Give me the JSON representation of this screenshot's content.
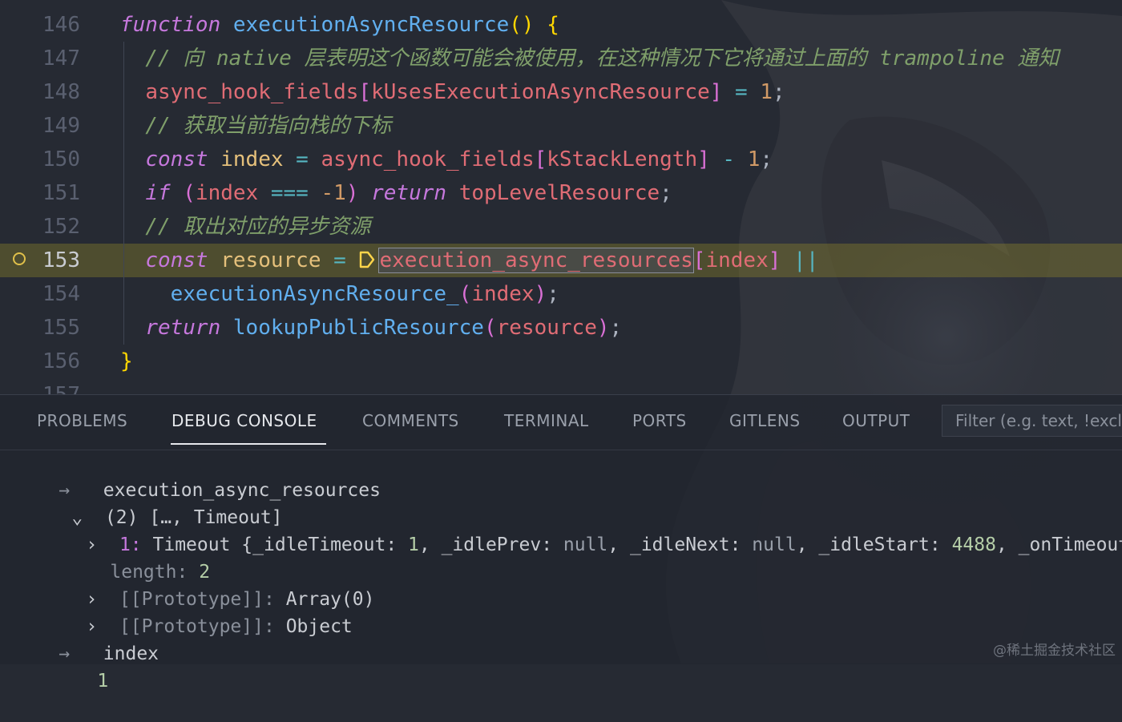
{
  "editor": {
    "lines": [
      {
        "num": "146",
        "tokens": [
          {
            "t": "function",
            "c": "k"
          },
          {
            "t": " ",
            "c": "plain"
          },
          {
            "t": "executionAsyncResource",
            "c": "fn"
          },
          {
            "t": "()",
            "c": "br"
          },
          {
            "t": " ",
            "c": "plain"
          },
          {
            "t": "{",
            "c": "br"
          }
        ]
      },
      {
        "num": "147",
        "tokens": [
          {
            "t": "  // 向 native 层表明这个函数可能会被使用，在这种情况下它将通过上面的 trampoline 通知",
            "c": "cm"
          }
        ]
      },
      {
        "num": "148",
        "tokens": [
          {
            "t": "  ",
            "c": "plain"
          },
          {
            "t": "async_hook_fields",
            "c": "var"
          },
          {
            "t": "[",
            "c": "br2"
          },
          {
            "t": "kUsesExecutionAsyncResource",
            "c": "var"
          },
          {
            "t": "]",
            "c": "br2"
          },
          {
            "t": " = ",
            "c": "op"
          },
          {
            "t": "1",
            "c": "num"
          },
          {
            "t": ";",
            "c": "plain"
          }
        ]
      },
      {
        "num": "149",
        "tokens": [
          {
            "t": "  // 获取当前指向栈的下标",
            "c": "cm"
          }
        ]
      },
      {
        "num": "150",
        "tokens": [
          {
            "t": "  ",
            "c": "plain"
          },
          {
            "t": "const",
            "c": "k"
          },
          {
            "t": " ",
            "c": "plain"
          },
          {
            "t": "index",
            "c": "loc"
          },
          {
            "t": " = ",
            "c": "op"
          },
          {
            "t": "async_hook_fields",
            "c": "var"
          },
          {
            "t": "[",
            "c": "br2"
          },
          {
            "t": "kStackLength",
            "c": "var"
          },
          {
            "t": "]",
            "c": "br2"
          },
          {
            "t": " - ",
            "c": "op"
          },
          {
            "t": "1",
            "c": "num"
          },
          {
            "t": ";",
            "c": "plain"
          }
        ]
      },
      {
        "num": "151",
        "tokens": [
          {
            "t": "  ",
            "c": "plain"
          },
          {
            "t": "if",
            "c": "k"
          },
          {
            "t": " ",
            "c": "plain"
          },
          {
            "t": "(",
            "c": "br2"
          },
          {
            "t": "index",
            "c": "var"
          },
          {
            "t": " === ",
            "c": "op"
          },
          {
            "t": "-1",
            "c": "num"
          },
          {
            "t": ")",
            "c": "br2"
          },
          {
            "t": " ",
            "c": "plain"
          },
          {
            "t": "return",
            "c": "k"
          },
          {
            "t": " ",
            "c": "plain"
          },
          {
            "t": "topLevelResource",
            "c": "var"
          },
          {
            "t": ";",
            "c": "plain"
          }
        ]
      },
      {
        "num": "152",
        "tokens": [
          {
            "t": "  // 取出对应的异步资源",
            "c": "cm"
          }
        ]
      },
      {
        "num": "153",
        "current": true,
        "tokens": [
          {
            "t": "  ",
            "c": "plain"
          },
          {
            "t": "const",
            "c": "k"
          },
          {
            "t": " ",
            "c": "plain"
          },
          {
            "t": "resource",
            "c": "loc"
          },
          {
            "t": " = ",
            "c": "op"
          },
          {
            "t": "INLINE_BP",
            "c": "bp"
          },
          {
            "t": "execution_async_resources",
            "c": "var",
            "boxed": true
          },
          {
            "t": "[",
            "c": "br2"
          },
          {
            "t": "index",
            "c": "var"
          },
          {
            "t": "]",
            "c": "br2"
          },
          {
            "t": " ||",
            "c": "op"
          }
        ]
      },
      {
        "num": "154",
        "tokens": [
          {
            "t": "    ",
            "c": "plain"
          },
          {
            "t": "executionAsyncResource_",
            "c": "fn"
          },
          {
            "t": "(",
            "c": "br2"
          },
          {
            "t": "index",
            "c": "var"
          },
          {
            "t": ")",
            "c": "br2"
          },
          {
            "t": ";",
            "c": "plain"
          }
        ]
      },
      {
        "num": "155",
        "tokens": [
          {
            "t": "  ",
            "c": "plain"
          },
          {
            "t": "return",
            "c": "k"
          },
          {
            "t": " ",
            "c": "plain"
          },
          {
            "t": "lookupPublicResource",
            "c": "fn"
          },
          {
            "t": "(",
            "c": "br2"
          },
          {
            "t": "resource",
            "c": "var"
          },
          {
            "t": ")",
            "c": "br2"
          },
          {
            "t": ";",
            "c": "plain"
          }
        ]
      },
      {
        "num": "156",
        "tokens": [
          {
            "t": "}",
            "c": "br"
          }
        ]
      },
      {
        "num": "157",
        "tokens": []
      }
    ]
  },
  "panel": {
    "tabs": [
      {
        "label": "PROBLEMS",
        "active": false
      },
      {
        "label": "DEBUG CONSOLE",
        "active": true
      },
      {
        "label": "COMMENTS",
        "active": false
      },
      {
        "label": "TERMINAL",
        "active": false
      },
      {
        "label": "PORTS",
        "active": false
      },
      {
        "label": "GITLENS",
        "active": false
      },
      {
        "label": "OUTPUT",
        "active": false
      }
    ],
    "filter_placeholder": "Filter (e.g. text, !exclude)"
  },
  "console": {
    "expr1": "execution_async_resources",
    "summary": "(2) […, Timeout]",
    "item1_key": "1:",
    "item1_type": "Timeout",
    "item1_body": [
      {
        "t": " {_idleTimeout: ",
        "c": "val-plain"
      },
      {
        "t": "1",
        "c": "val-num"
      },
      {
        "t": ", _idlePrev: ",
        "c": "val-plain"
      },
      {
        "t": "null",
        "c": "val-null"
      },
      {
        "t": ", _idleNext: ",
        "c": "val-plain"
      },
      {
        "t": "null",
        "c": "val-null"
      },
      {
        "t": ", _idleStart: ",
        "c": "val-plain"
      },
      {
        "t": "4488",
        "c": "val-num"
      },
      {
        "t": ", _onTimeout: ",
        "c": "val-plain"
      }
    ],
    "length_key": "length:",
    "length_val": "2",
    "proto1_key": "[[Prototype]]:",
    "proto1_val": "Array(0)",
    "proto2_key": "[[Prototype]]:",
    "proto2_val": "Object",
    "expr2": "index",
    "expr2_val": "1"
  },
  "icons": {
    "breakpoint": "breakpoint-circle-icon",
    "inline_breakpoint": "inline-breakpoint-icon",
    "arrow": "input-arrow-icon",
    "chevron_down": "chevron-down-icon",
    "chevron_right": "chevron-right-icon"
  },
  "watermark": "@稀土掘金技术社区",
  "colors": {
    "accent_highlight": "#a0962899",
    "comment": "#7f9f6a",
    "keyword": "#c678dd"
  }
}
